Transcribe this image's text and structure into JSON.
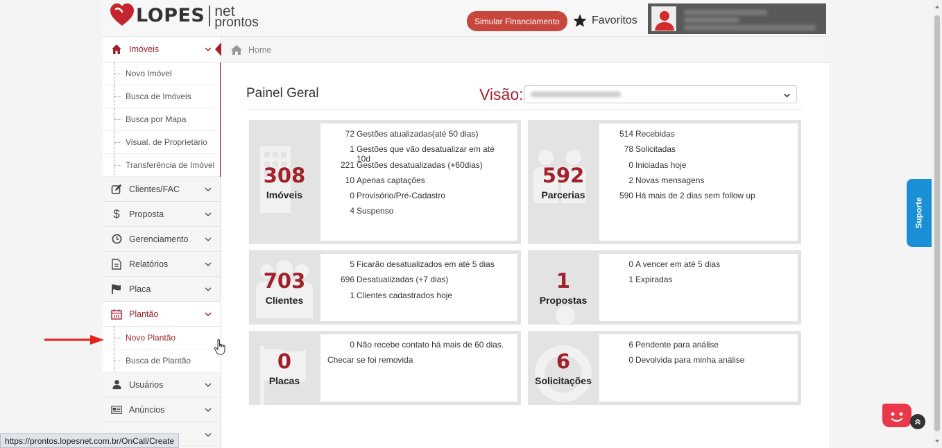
{
  "header": {
    "logo_main": "LOPES",
    "logo_sub1": "net",
    "logo_sub2": "pronto s",
    "simulate_button": "Simular Financiamento",
    "favorites_label": "Favoritos"
  },
  "sidebar": {
    "imoveis": {
      "label": "Imóveis",
      "subitems": [
        "Novo Imóvel",
        "Busca de Imóveis",
        "Busca por Mapa",
        "Visual. de Proprietário",
        "Transferência de Imóvel"
      ]
    },
    "clientes": {
      "label": "Clientes/FAC"
    },
    "proposta": {
      "label": "Proposta"
    },
    "gerenciamento": {
      "label": "Gerenciamento"
    },
    "relatorios": {
      "label": "Relatórios"
    },
    "placa": {
      "label": "Placa"
    },
    "plantao": {
      "label": "Plantão",
      "subitems": [
        "Novo Plantão",
        "Busca de Plantão"
      ]
    },
    "usuarios": {
      "label": "Usuários"
    },
    "anuncios": {
      "label": "Anúncios"
    }
  },
  "breadcrumb": {
    "home": "Home"
  },
  "main": {
    "panel_title": "Painel Geral",
    "visao_label": "Visão:"
  },
  "cards": {
    "imoveis": {
      "number": "308",
      "label": "Imóveis",
      "stats": [
        {
          "n": "72",
          "t": "Gestões atualizadas(até 50 dias)"
        },
        {
          "n": "1",
          "t": "Gestões que vão desatualizar em até 10d"
        },
        {
          "n": "221",
          "t": "Gestões desatualizadas (+60dias)"
        },
        {
          "n": "10",
          "t": "Apenas captações"
        },
        {
          "n": "0",
          "t": "Provisório/Pré-Cadastro"
        },
        {
          "n": "4",
          "t": "Suspenso"
        }
      ]
    },
    "parcerias": {
      "number": "592",
      "label": "Parcerias",
      "stats": [
        {
          "n": "514",
          "t": "Recebidas"
        },
        {
          "n": "78",
          "t": "Solicitadas"
        },
        {
          "n": "0",
          "t": "Iniciadas hoje"
        },
        {
          "n": "2",
          "t": "Novas mensagens"
        },
        {
          "n": "590",
          "t": "Há mais de 2 dias sem follow up"
        }
      ]
    },
    "clientes": {
      "number": "703",
      "label": "Clientes",
      "stats": [
        {
          "n": "5",
          "t": "Ficarão desatualizados em até 5 dias"
        },
        {
          "n": "696",
          "t": "Desatualizadas (+7 dias)"
        },
        {
          "n": "1",
          "t": "Clientes cadastrados hoje"
        }
      ]
    },
    "propostas": {
      "number": "1",
      "label": "Propostas",
      "stats": [
        {
          "n": "0",
          "t": "A vencer em até 5 dias"
        },
        {
          "n": "1",
          "t": "Expiradas"
        }
      ]
    },
    "placas": {
      "number": "0",
      "label": "Placas",
      "stats": [
        {
          "n": "0",
          "t": "Não recebe contato há mais de 60 dias."
        }
      ],
      "note": "Checar se foi removida"
    },
    "solicitacoes": {
      "number": "6",
      "label": "Solicitações",
      "stats": [
        {
          "n": "6",
          "t": "Pendente para análise"
        },
        {
          "n": "0",
          "t": "Devolvida para minha análise"
        }
      ]
    }
  },
  "suporte_label": "Suporte",
  "status_url": "https://prontos.lopesnet.com.br/OnCall/Create",
  "colors": {
    "brand_red": "#a2202a",
    "button_red": "#c8473d",
    "suporte_blue": "#1b8fd5"
  }
}
